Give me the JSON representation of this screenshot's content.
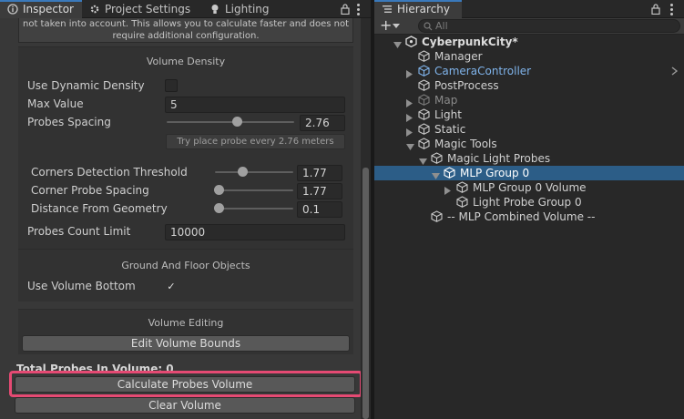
{
  "inspector": {
    "tabs": [
      {
        "label": "Inspector",
        "icon": "info-icon",
        "active": true
      },
      {
        "label": "Project Settings",
        "icon": "gear-icon",
        "active": false
      },
      {
        "label": "Lighting",
        "icon": "lightbulb-icon",
        "active": false
      }
    ],
    "help_text_line1": "not taken into account. This allows you to calculate faster and does not",
    "help_text_line2": "require additional configuration.",
    "volume_density": {
      "title": "Volume Density",
      "use_dynamic_density_label": "Use Dynamic Density",
      "use_dynamic_density_checked": false,
      "max_value_label": "Max Value",
      "max_value": "5",
      "probes_spacing_label": "Probes Spacing",
      "probes_spacing_value": "2.76",
      "probes_spacing_slider_fraction": 0.55,
      "probes_spacing_hint": "Try place probe every 2.76 meters",
      "corners_threshold_label": "Corners Detection Threshold",
      "corners_threshold_value": "1.77",
      "corners_threshold_slider_fraction": 0.35,
      "corner_probe_spacing_label": "Corner Probe Spacing",
      "corner_probe_spacing_value": "1.77",
      "corner_probe_spacing_slider_fraction": 0.05,
      "distance_from_geometry_label": "Distance From Geometry",
      "distance_from_geometry_value": "0.1",
      "distance_from_geometry_slider_fraction": 0.05,
      "probes_count_limit_label": "Probes Count Limit",
      "probes_count_limit_value": "10000"
    },
    "ground_floor": {
      "title": "Ground And Floor Objects",
      "use_volume_bottom_label": "Use Volume Bottom",
      "use_volume_bottom_checked": true,
      "check_glyph": "✓"
    },
    "volume_editing": {
      "title": "Volume Editing",
      "edit_bounds_button": "Edit Volume Bounds"
    },
    "total_probes_text": "Total Probes In Volume: 0",
    "calculate_button": "Calculate Probes Volume",
    "clear_button": "Clear Volume"
  },
  "hierarchy": {
    "tab_label": "Hierarchy",
    "search_placeholder": "All",
    "add_glyph": "+",
    "items": [
      {
        "label": "CyberpunkCity*",
        "depth": 0,
        "expanded": true,
        "has_children": true,
        "style": "bold",
        "icon": "unity-scene-icon"
      },
      {
        "label": "Manager",
        "depth": 1,
        "has_children": false,
        "style": "normal",
        "icon": "gameobject-cube-icon"
      },
      {
        "label": "CameraController",
        "depth": 1,
        "has_children": true,
        "expanded": false,
        "style": "prefab",
        "icon": "prefab-cube-icon"
      },
      {
        "label": "PostProcess",
        "depth": 1,
        "has_children": false,
        "style": "normal",
        "icon": "gameobject-cube-icon"
      },
      {
        "label": "Map",
        "depth": 1,
        "has_children": true,
        "expanded": false,
        "style": "disabled",
        "icon": "gameobject-cube-icon"
      },
      {
        "label": "Light",
        "depth": 1,
        "has_children": true,
        "expanded": false,
        "style": "normal",
        "icon": "gameobject-cube-icon"
      },
      {
        "label": "Static",
        "depth": 1,
        "has_children": true,
        "expanded": false,
        "style": "normal",
        "icon": "gameobject-cube-icon"
      },
      {
        "label": "Magic Tools",
        "depth": 1,
        "has_children": true,
        "expanded": true,
        "style": "normal",
        "icon": "gameobject-cube-icon"
      },
      {
        "label": "Magic Light Probes",
        "depth": 2,
        "has_children": true,
        "expanded": true,
        "style": "normal",
        "icon": "gameobject-cube-icon"
      },
      {
        "label": "MLP Group 0",
        "depth": 3,
        "has_children": true,
        "expanded": true,
        "style": "selected",
        "icon": "gameobject-cube-icon"
      },
      {
        "label": "MLP Group 0 Volume",
        "depth": 4,
        "has_children": true,
        "expanded": false,
        "style": "normal",
        "icon": "gameobject-cube-icon"
      },
      {
        "label": "Light Probe Group 0",
        "depth": 4,
        "has_children": false,
        "style": "normal",
        "icon": "gameobject-cube-icon"
      },
      {
        "label": "-- MLP Combined Volume --",
        "depth": 2,
        "has_children": false,
        "style": "normal",
        "icon": "gameobject-cube-icon"
      }
    ]
  }
}
